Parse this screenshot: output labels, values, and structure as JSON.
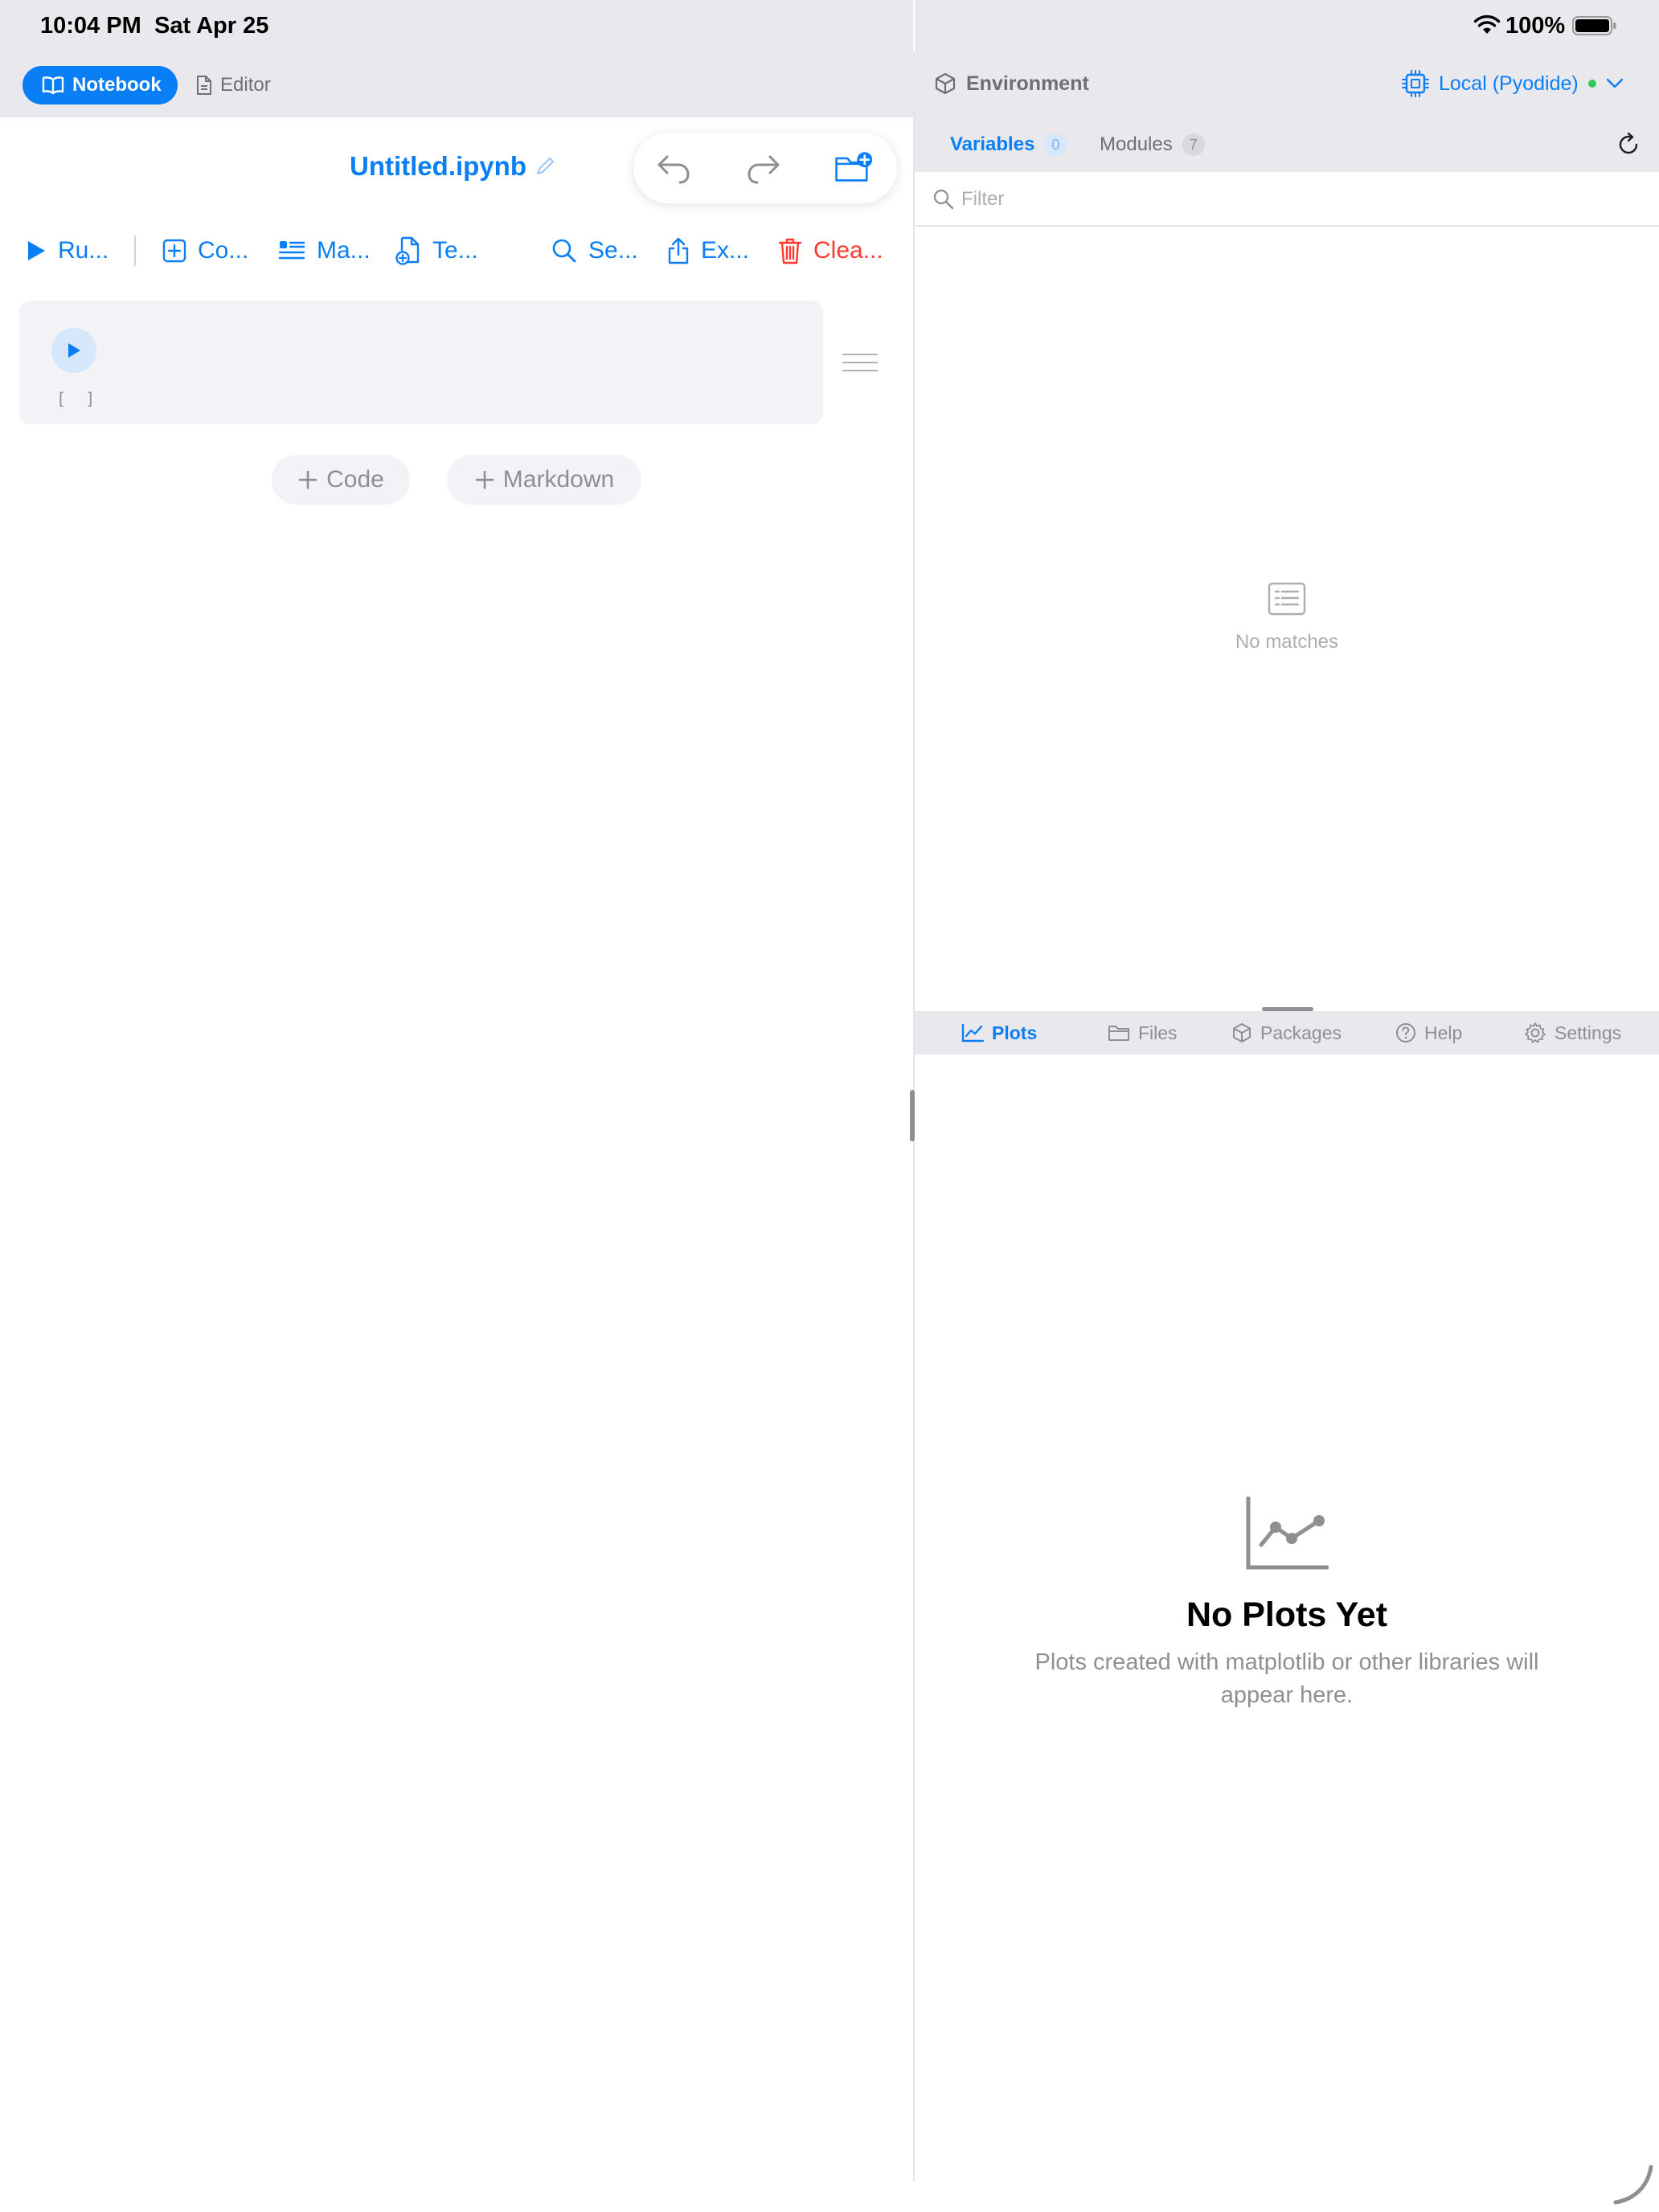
{
  "status_bar": {
    "time": "10:04 PM",
    "date": "Sat Apr 25",
    "battery_percent": "100%"
  },
  "left_header": {
    "notebook_label": "Notebook",
    "editor_label": "Editor"
  },
  "notebook": {
    "title": "Untitled.ipynb"
  },
  "toolbar": {
    "run_label": "Ru...",
    "code_label": "Co...",
    "markdown_label": "Ma...",
    "template_label": "Te...",
    "search_label": "Se...",
    "export_label": "Ex...",
    "clear_label": "Clea..."
  },
  "cell": {
    "execution_count": "[ ]"
  },
  "add_cell": {
    "code_label": "Code",
    "markdown_label": "Markdown"
  },
  "environment": {
    "title": "Environment",
    "runtime_label": "Local (Pyodide)",
    "status_color": "#34c759"
  },
  "env_tabs": {
    "variables_label": "Variables",
    "variables_count": "0",
    "modules_label": "Modules",
    "modules_count": "7"
  },
  "filter": {
    "placeholder": "Filter",
    "value": ""
  },
  "variables_empty": {
    "text": "No matches"
  },
  "bottom_tabs": {
    "plots_label": "Plots",
    "files_label": "Files",
    "packages_label": "Packages",
    "help_label": "Help",
    "settings_label": "Settings"
  },
  "plots_empty": {
    "title": "No Plots Yet",
    "subtitle": "Plots created with matplotlib or other libraries will appear here."
  },
  "colors": {
    "accent": "#0a7ff5",
    "danger": "#ff3b30",
    "chrome": "#e8e8ed"
  }
}
